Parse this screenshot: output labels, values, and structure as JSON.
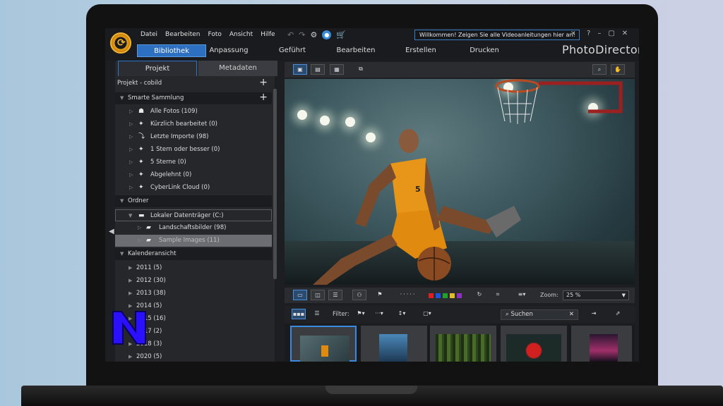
{
  "menu": [
    "Datei",
    "Bearbeiten",
    "Foto",
    "Ansicht",
    "Hilfe"
  ],
  "welcome_message": "Willkommen! Zeigen Sie alle Videoanleitungen hier an!",
  "window_controls": [
    "?",
    "–",
    "▢",
    "✕"
  ],
  "tabs": [
    "Bibliothek",
    "Anpassung",
    "Geführt",
    "Bearbeiten",
    "Erstellen",
    "Drucken"
  ],
  "active_tab": "Bibliothek",
  "brand": "PhotoDirector",
  "panel_tabs": [
    "Projekt",
    "Metadaten"
  ],
  "project_row": "Projekt - cobild",
  "smart_collection": {
    "header": "Smarte Sammlung",
    "items": [
      "Alle Fotos (109)",
      "Kürzlich bearbeitet (0)",
      "Letzte Importe (98)",
      "1 Stern oder besser (0)",
      "5 Sterne (0)",
      "Abgelehnt (0)",
      "CyberLink Cloud (0)"
    ]
  },
  "folders": {
    "header": "Ordner",
    "items": [
      "Lokaler Datenträger (C:)",
      "Landschaftsbilder (98)",
      "Sample Images (11)"
    ]
  },
  "calendar": {
    "header": "Kalenderansicht",
    "items": [
      "2011 (5)",
      "2012 (30)",
      "2013 (38)",
      "2014 (5)",
      "2015 (16)",
      "2017 (2)",
      "2018 (3)",
      "2020 (5)"
    ]
  },
  "bottom_toolbar": {
    "zoom_label": "Zoom:",
    "zoom_value": "25 %",
    "color_labels": [
      "#e02020",
      "#2050e0",
      "#20a030",
      "#e0c020",
      "#9030c0"
    ]
  },
  "filter_bar": {
    "filter_label": "Filter:",
    "search_placeholder": "Suchen"
  },
  "player_number": "5",
  "overlay_logo_letter": "N"
}
